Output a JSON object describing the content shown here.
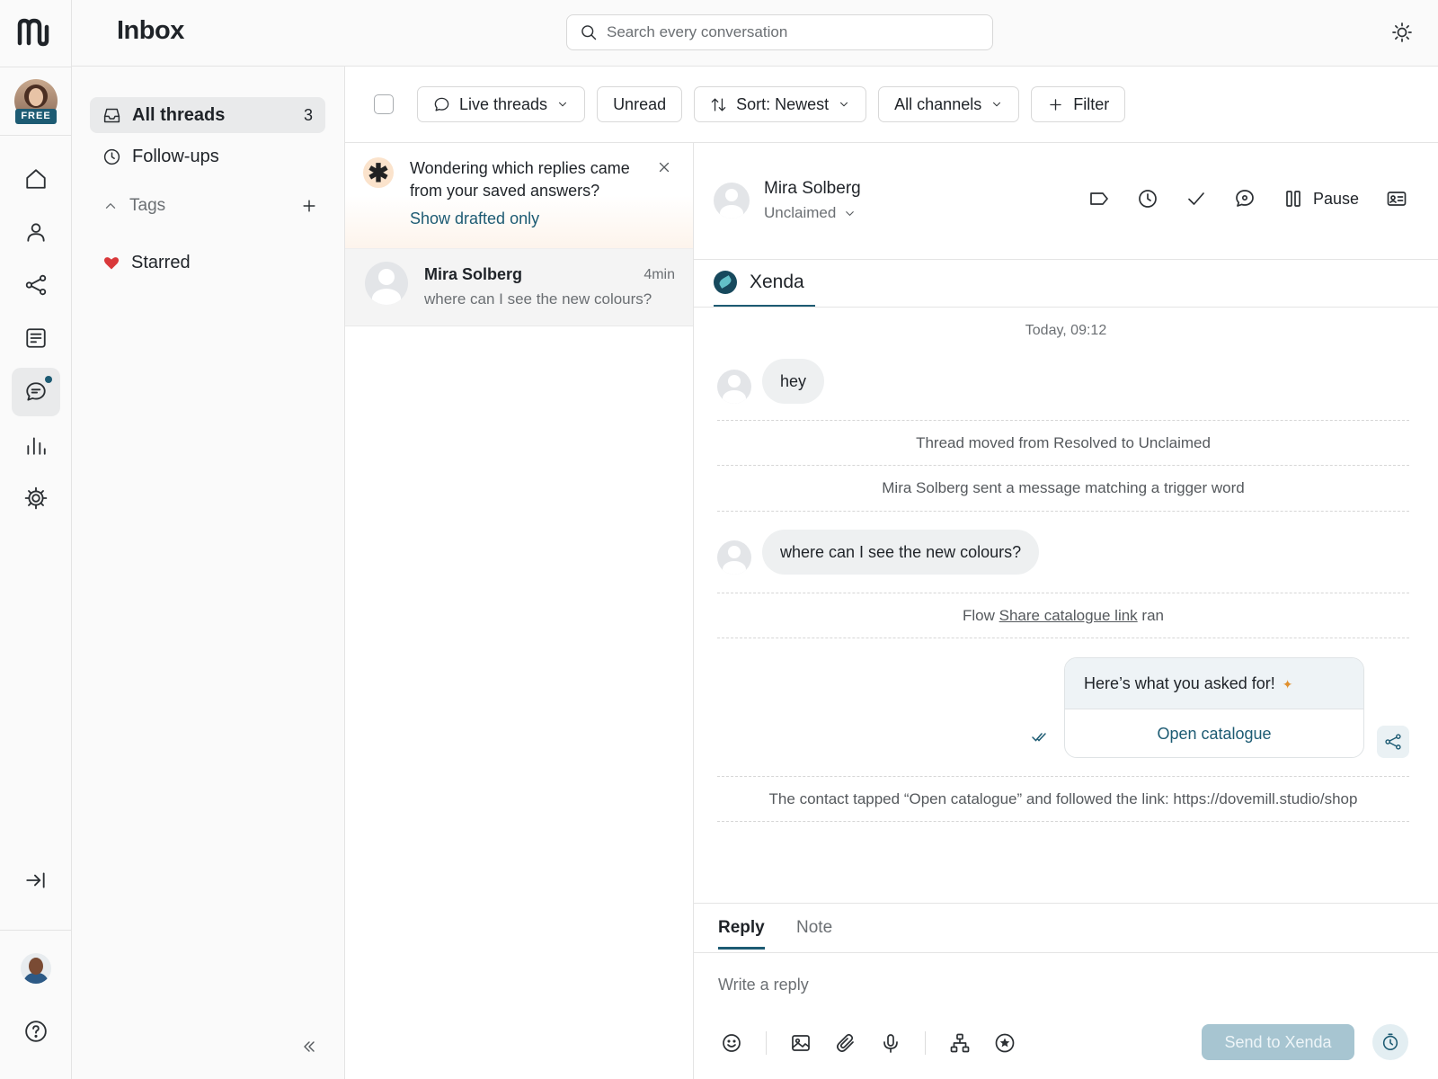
{
  "app": {
    "logo_icon": "app-logo-m",
    "brand_color": "#1d5b73"
  },
  "rail": {
    "org_badge": "FREE",
    "items": [
      {
        "name": "home-icon"
      },
      {
        "name": "contacts-icon"
      },
      {
        "name": "flows-icon"
      },
      {
        "name": "broadcasts-icon"
      },
      {
        "name": "inbox-icon",
        "active": true,
        "has_notification": true
      },
      {
        "name": "analytics-icon"
      },
      {
        "name": "settings-icon"
      }
    ],
    "expand_icon": "expand-rail-icon",
    "help_icon": "help-icon"
  },
  "header": {
    "title": "Inbox",
    "search_placeholder": "Search every conversation",
    "theme_icon": "sun-icon"
  },
  "folders": {
    "items": [
      {
        "label": "All threads",
        "count": "3",
        "icon": "tray-icon",
        "active": true
      },
      {
        "label": "Follow-ups",
        "icon": "clock-icon"
      }
    ],
    "tags_label": "Tags",
    "tags": [
      {
        "label": "Starred",
        "color": "#d9383a",
        "icon": "heart-icon"
      }
    ]
  },
  "toolbar": {
    "live_threads": "Live threads",
    "unread": "Unread",
    "sort": "Sort: Newest",
    "channels": "All channels",
    "filter": "Filter"
  },
  "tip": {
    "text": "Wondering which replies came from your saved answers?",
    "link": "Show drafted only"
  },
  "threads": [
    {
      "name": "Mira Solberg",
      "time": "4min",
      "preview": "where can I see the new colours?"
    }
  ],
  "conversation": {
    "contact_name": "Mira Solberg",
    "contact_status": "Unclaimed",
    "pause_label": "Pause",
    "channel_name": "Xenda",
    "date_separator": "Today, 09:12",
    "msg1": "hey",
    "event1": "Thread moved from Resolved to Unclaimed",
    "event2": "Mira Solberg sent a message matching a trigger word",
    "msg2": "where can I see the new colours?",
    "event3_prefix": "Flow ",
    "event3_link": "Share catalogue link",
    "event3_suffix": " ran",
    "bot_message": "Here’s what you asked for!",
    "bot_button": "Open catalogue",
    "event4": "The contact tapped “Open catalogue” and followed the link: https://dovemill.studio/shop"
  },
  "composer": {
    "tab_reply": "Reply",
    "tab_note": "Note",
    "placeholder": "Write a reply",
    "send_label": "Send to Xenda"
  }
}
